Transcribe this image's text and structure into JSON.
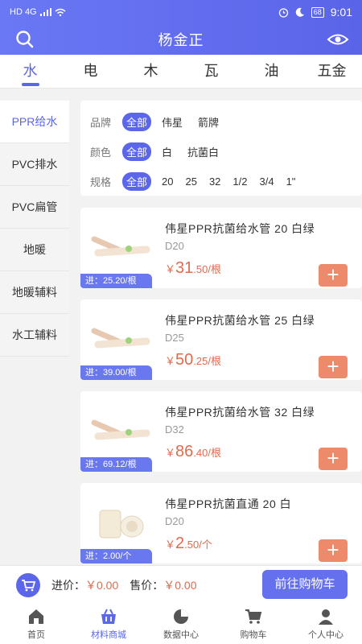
{
  "status": {
    "time": "9:01",
    "battery": "68",
    "network": "HD 4G"
  },
  "header": {
    "title": "杨金正"
  },
  "tabs": [
    "水",
    "电",
    "木",
    "瓦",
    "油",
    "五金"
  ],
  "active_tab": 0,
  "sidebar": [
    "PPR给水",
    "PVC排水",
    "PVC扁管",
    "地暖",
    "地暖辅料",
    "水工辅料"
  ],
  "filters": {
    "brand": {
      "label": "品牌",
      "selected": "全部",
      "options": [
        "伟星",
        "箭牌"
      ]
    },
    "color": {
      "label": "颜色",
      "selected": "全部",
      "options": [
        "白",
        "抗菌白"
      ]
    },
    "spec": {
      "label": "规格",
      "selected": "全部",
      "options": [
        "20",
        "25",
        "32",
        "1/2",
        "3/4",
        "1\""
      ]
    }
  },
  "products": [
    {
      "name": "伟星PPR抗菌给水管 20 白绿",
      "spec": "D20",
      "currency": "￥",
      "price_int": "31",
      "price_dec": ".50/根",
      "cost": "进：25.20/根"
    },
    {
      "name": "伟星PPR抗菌给水管 25 白绿",
      "spec": "D25",
      "currency": "￥",
      "price_int": "50",
      "price_dec": ".25/根",
      "cost": "进：39.00/根"
    },
    {
      "name": "伟星PPR抗菌给水管 32 白绿",
      "spec": "D32",
      "currency": "￥",
      "price_int": "86",
      "price_dec": ".40/根",
      "cost": "进：69.12/根"
    },
    {
      "name": "伟星PPR抗菌直通 20 白",
      "spec": "D20",
      "currency": "￥",
      "price_int": "2",
      "price_dec": ".50/个",
      "cost": "进：2.00/个"
    }
  ],
  "cart": {
    "cost_label": "进价：",
    "cost_value": "￥0.00",
    "sale_label": "售价：",
    "sale_value": "￥0.00",
    "checkout": "前往购物车"
  },
  "nav": [
    "首页",
    "材料商城",
    "数据中心",
    "购物车",
    "个人中心"
  ],
  "colors": {
    "accent": "#5b66ea",
    "price": "#e06a4e",
    "add_button": "#ee8a6c"
  }
}
